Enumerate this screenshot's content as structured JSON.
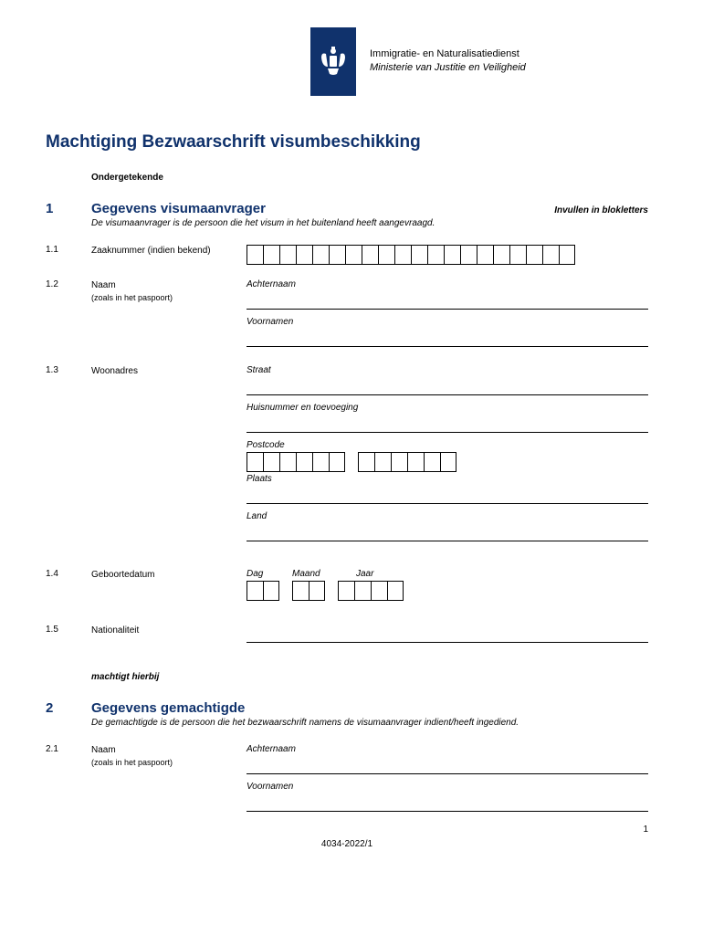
{
  "header": {
    "org_line1": "Immigratie- en Naturalisatiedienst",
    "org_line2": "Ministerie van Justitie en Veiligheid"
  },
  "title": "Machtiging Bezwaarschrift visumbeschikking",
  "preamble": "Ondergetekende",
  "section1": {
    "num": "1",
    "title": "Gegevens visumaanvrager",
    "hint": "Invullen in blokletters",
    "desc": "De visumaanvrager is de persoon die het visum in het buitenland heeft aangevraagd.",
    "f11": {
      "num": "1.1",
      "label": "Zaaknummer (indien bekend)"
    },
    "f12": {
      "num": "1.2",
      "label": "Naam",
      "sublabel": "(zoals in het paspoort)",
      "sub1": "Achternaam",
      "sub2": "Voornamen"
    },
    "f13": {
      "num": "1.3",
      "label": "Woonadres",
      "sub1": "Straat",
      "sub2": "Huisnummer en toevoeging",
      "sub3": "Postcode",
      "sub4": "Plaats",
      "sub5": "Land"
    },
    "f14": {
      "num": "1.4",
      "label": "Geboortedatum",
      "d": "Dag",
      "m": "Maand",
      "y": "Jaar"
    },
    "f15": {
      "num": "1.5",
      "label": "Nationaliteit"
    }
  },
  "machtigt": "machtigt hierbij",
  "section2": {
    "num": "2",
    "title": "Gegevens gemachtigde",
    "desc": "De gemachtigde is de persoon die het bezwaarschrift namens de visumaanvrager indient/heeft ingediend.",
    "f21": {
      "num": "2.1",
      "label": "Naam",
      "sublabel": "(zoals in het paspoort)",
      "sub1": "Achternaam",
      "sub2": "Voornamen"
    }
  },
  "footer": {
    "page": "1",
    "ref": "4034-2022/1"
  }
}
